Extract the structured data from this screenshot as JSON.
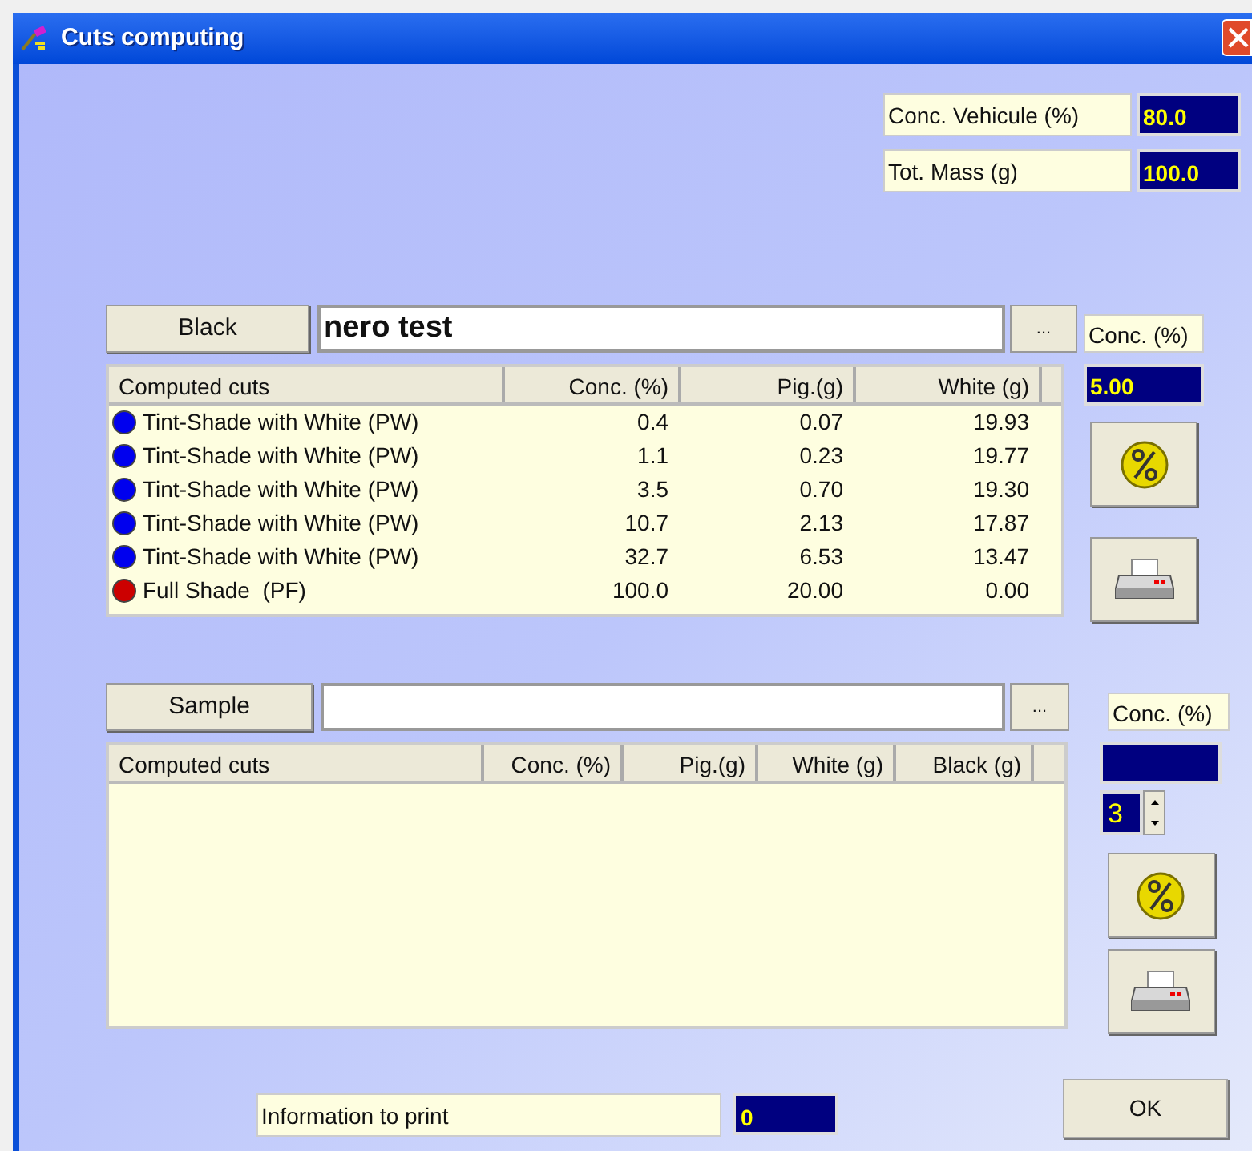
{
  "window": {
    "title": "Cuts computing"
  },
  "vehicle_conc": {
    "label": "Conc. Vehicule (%)",
    "value": "80.0"
  },
  "total_mass": {
    "label": "Tot. Mass (g)",
    "value": "100.0"
  },
  "black": {
    "button": "Black",
    "name": "nero test",
    "browse": "...",
    "conc_label": "Conc. (%)",
    "conc_value": "5.00",
    "table": {
      "columns": [
        "Computed cuts",
        "Conc. (%)",
        "Pig.(g)",
        "White (g)"
      ],
      "rows": [
        {
          "color": "#0000ee",
          "cells": [
            "Tint-Shade with White (PW)",
            "0.4",
            "0.07",
            "19.93"
          ]
        },
        {
          "color": "#0000ee",
          "cells": [
            "Tint-Shade with White (PW)",
            "1.1",
            "0.23",
            "19.77"
          ]
        },
        {
          "color": "#0000ee",
          "cells": [
            "Tint-Shade with White (PW)",
            "3.5",
            "0.70",
            "19.30"
          ]
        },
        {
          "color": "#0000ee",
          "cells": [
            "Tint-Shade with White (PW)",
            "10.7",
            "2.13",
            "17.87"
          ]
        },
        {
          "color": "#0000ee",
          "cells": [
            "Tint-Shade with White (PW)",
            "32.7",
            "6.53",
            "13.47"
          ]
        },
        {
          "color": "#cc0000",
          "cells": [
            "Full Shade  (PF)",
            "100.0",
            "20.00",
            "0.00"
          ]
        }
      ]
    }
  },
  "sample": {
    "button": "Sample",
    "browse": "...",
    "conc_label": "Conc. (%)",
    "steps": "3",
    "table": {
      "columns": [
        "Computed cuts",
        "Conc. (%)",
        "Pig.(g)",
        "White (g)",
        "Black (g)"
      ]
    }
  },
  "info": {
    "label": "Information to print",
    "value": "0"
  },
  "ok_button": "OK"
}
